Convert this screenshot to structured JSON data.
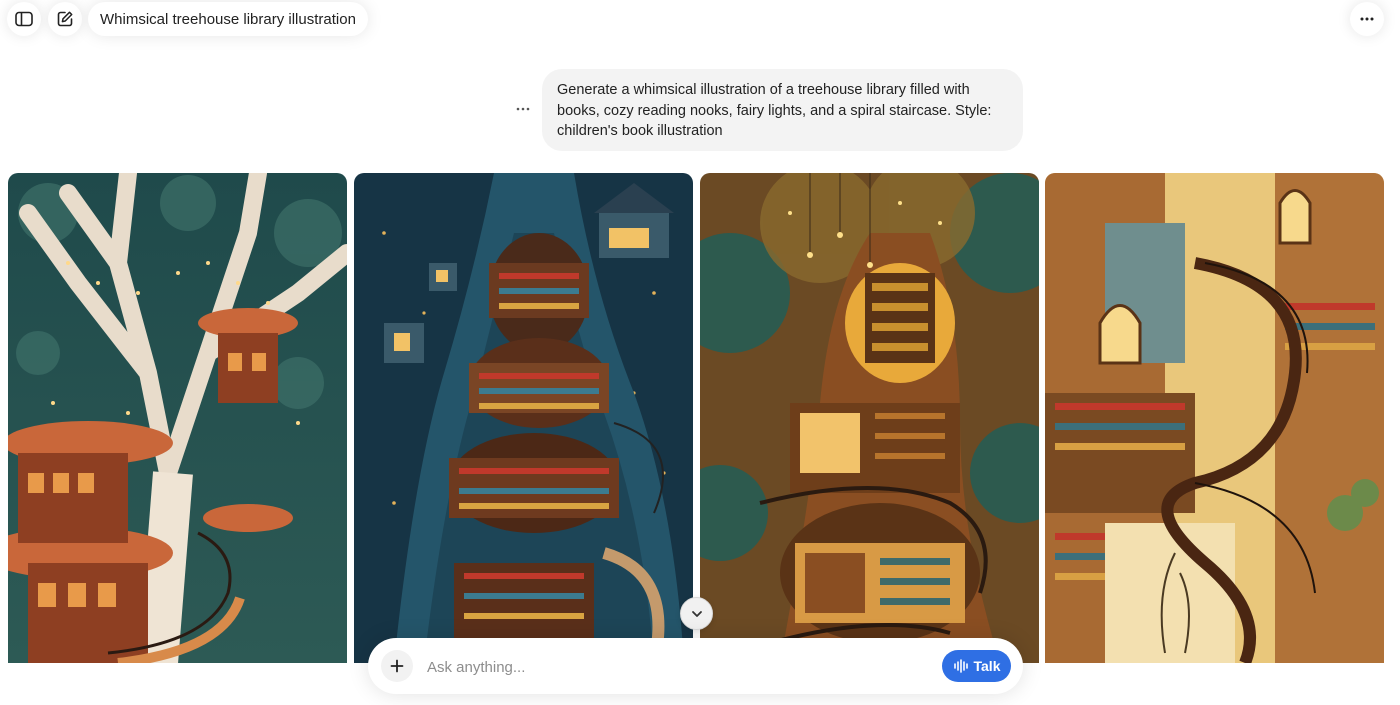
{
  "header": {
    "title": "Whimsical treehouse library illustration",
    "sidebar_icon": "sidebar-toggle-icon",
    "new_chat_icon": "new-chat-icon",
    "more_icon": "more-options-icon"
  },
  "conversation": {
    "user_message": "Generate a whimsical illustration of a treehouse library filled with books, cozy reading nooks, fairy lights, and a spiral staircase. Style: children's book illustration",
    "message_actions_icon": "message-more-icon"
  },
  "gallery": {
    "images": [
      {
        "alt": "Treehouse library with white tree and orange platforms",
        "theme": "teal-orange"
      },
      {
        "alt": "Blue tree trunk with stacked library rooms",
        "theme": "deep-blue"
      },
      {
        "alt": "Warm golden tree with glowing library floors",
        "theme": "golden-green"
      },
      {
        "alt": "Sunlit treehouse with wooden spiral staircase",
        "theme": "cream-brown"
      }
    ]
  },
  "composer": {
    "placeholder": "Ask anything...",
    "talk_label": "Talk",
    "accent_color": "#2f6fe4"
  },
  "scroll_icon": "chevron-down-icon"
}
